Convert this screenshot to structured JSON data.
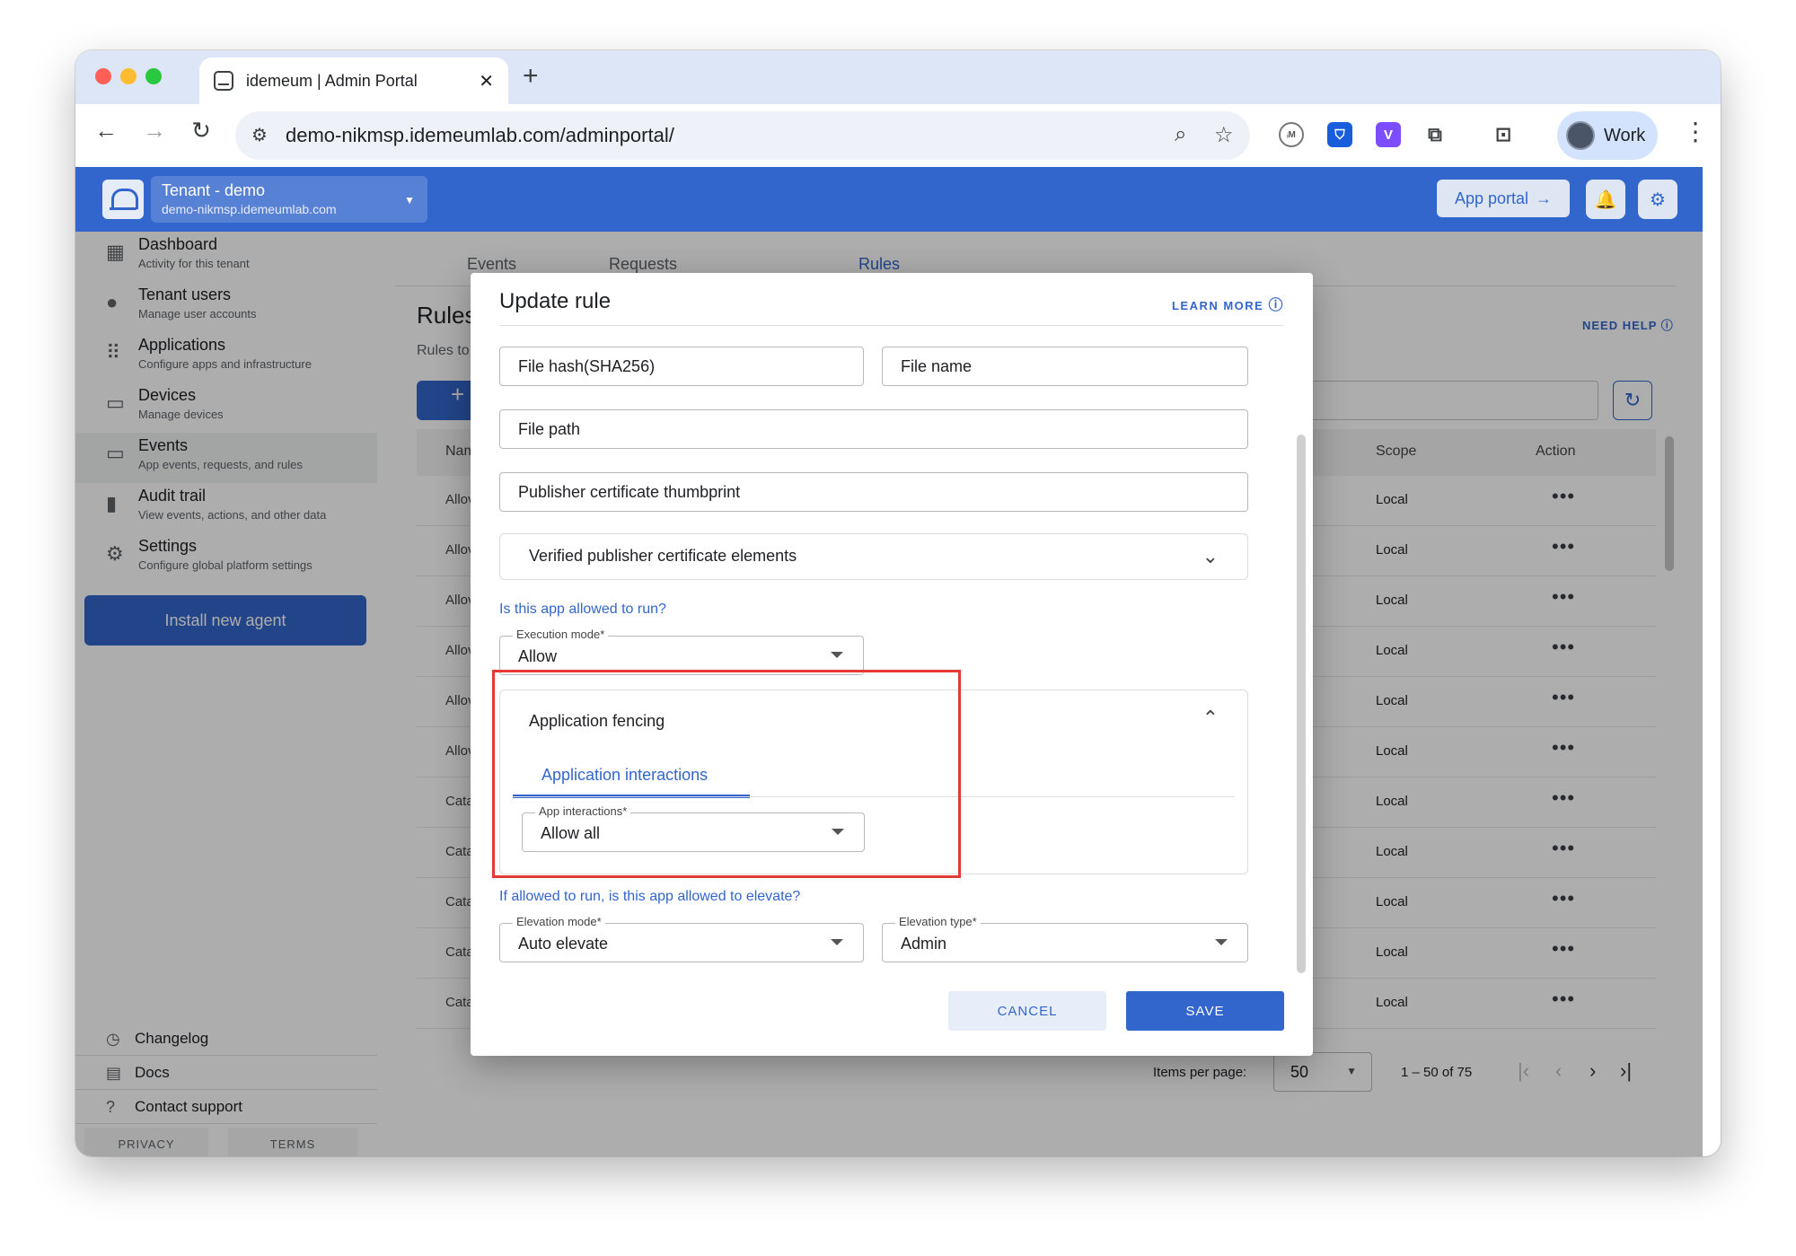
{
  "browser": {
    "tab_title": "idemeum | Admin Portal",
    "url": "demo-nikmsp.idemeumlab.com/adminportal/",
    "profile_label": "Work",
    "extensions": [
      "idm-extension-icon",
      "bitwarden-icon",
      "v-extension-icon",
      "puzzle-icon",
      "tab-search-icon"
    ]
  },
  "header": {
    "tenant_name": "Tenant - demo",
    "tenant_domain": "demo-nikmsp.idemeumlab.com",
    "app_portal_label": "App portal"
  },
  "sidebar": {
    "items": [
      {
        "title": "Dashboard",
        "subtitle": "Activity for this tenant",
        "icon": "dashboard-icon"
      },
      {
        "title": "Tenant users",
        "subtitle": "Manage user accounts",
        "icon": "user-icon"
      },
      {
        "title": "Applications",
        "subtitle": "Configure apps and infrastructure",
        "icon": "apps-grid-icon"
      },
      {
        "title": "Devices",
        "subtitle": "Manage devices",
        "icon": "monitor-icon"
      },
      {
        "title": "Events",
        "subtitle": "App events, requests, and rules",
        "icon": "devices-icon"
      },
      {
        "title": "Audit trail",
        "subtitle": "View events, actions, and other data",
        "icon": "bar-chart-icon"
      },
      {
        "title": "Settings",
        "subtitle": "Configure global platform settings",
        "icon": "gear-icon"
      }
    ],
    "install_button": "Install new agent",
    "footer_links": [
      "Changelog",
      "Docs",
      "Contact support"
    ],
    "legal": [
      "PRIVACY",
      "TERMS"
    ]
  },
  "content": {
    "tabs": [
      "Events",
      "Requests",
      "Rules"
    ],
    "active_tab": "Rules",
    "title": "Rules",
    "subtitle": "Rules to",
    "add_label": "+",
    "need_help": "NEED HELP",
    "columns": {
      "name": "Nam",
      "scope": "Scope",
      "action": "Action"
    },
    "rows": [
      {
        "name": "Allov",
        "scope": "Local"
      },
      {
        "name": "Allov",
        "scope": "Local"
      },
      {
        "name": "Allov",
        "scope": "Local"
      },
      {
        "name": "Allov",
        "scope": "Local"
      },
      {
        "name": "Allov",
        "scope": "Local"
      },
      {
        "name": "Allov",
        "scope": "Local"
      },
      {
        "name": "Cata",
        "scope": "Local"
      },
      {
        "name": "Cata",
        "scope": "Local"
      },
      {
        "name": "Cata",
        "scope": "Local"
      },
      {
        "name": "Cata",
        "scope": "Local"
      },
      {
        "name": "Cata",
        "scope": "Local"
      }
    ],
    "action_glyph": "•••",
    "pagination": {
      "items_per_page_label": "Items per page:",
      "items_per_page": "50",
      "range": "1 – 50 of 75"
    }
  },
  "modal": {
    "title": "Update rule",
    "learn_more": "LEARN MORE",
    "file_hash": "File hash(SHA256)",
    "file_name": "File name",
    "file_path": "File path",
    "publisher_thumbprint": "Publisher certificate thumbprint",
    "verified_publisher": "Verified publisher certificate elements",
    "run_question": "Is this app allowed to run?",
    "execution_mode_label": "Execution mode*",
    "execution_mode_value": "Allow",
    "fencing_title": "Application fencing",
    "fencing_tab": "Application interactions",
    "app_interactions_label": "App interactions*",
    "app_interactions_value": "Allow all",
    "elevate_question": "If allowed to run, is this app allowed to elevate?",
    "elevation_mode_label": "Elevation mode*",
    "elevation_mode_value": "Auto elevate",
    "elevation_type_label": "Elevation type*",
    "elevation_type_value": "Admin",
    "cancel": "CANCEL",
    "save": "SAVE"
  },
  "colors": {
    "brand": "#3366cc",
    "highlight": "#e53935"
  }
}
